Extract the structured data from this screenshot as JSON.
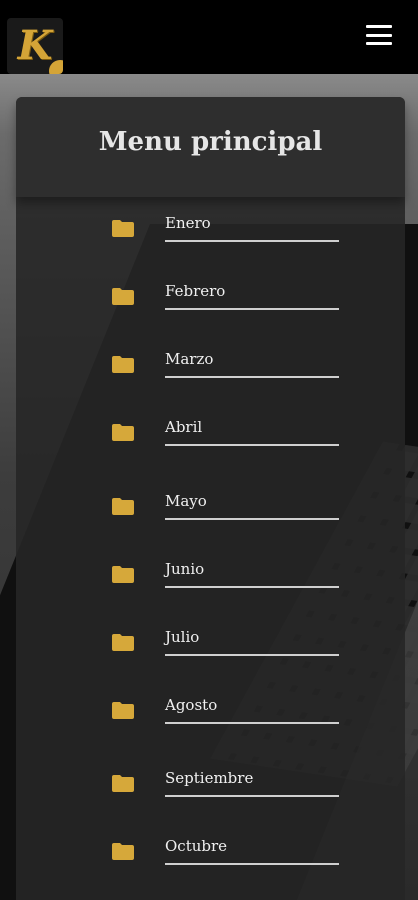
{
  "header": {
    "logo_letter": "K",
    "menu_icon": "hamburger-menu-icon"
  },
  "panel": {
    "title": "Menu principal",
    "items": [
      {
        "label": "Enero",
        "icon": "folder-icon"
      },
      {
        "label": "Febrero",
        "icon": "folder-icon"
      },
      {
        "label": "Marzo",
        "icon": "folder-icon"
      },
      {
        "label": "Abril",
        "icon": "folder-icon"
      },
      {
        "label": "Mayo",
        "icon": "folder-icon"
      },
      {
        "label": "Junio",
        "icon": "folder-icon"
      },
      {
        "label": "Julio",
        "icon": "folder-icon"
      },
      {
        "label": "Agosto",
        "icon": "folder-icon"
      },
      {
        "label": "Septiembre",
        "icon": "folder-icon"
      },
      {
        "label": "Octubre",
        "icon": "folder-icon"
      }
    ]
  },
  "colors": {
    "accent": "#d4a437",
    "folder": "#d6a83a",
    "topbar": "#000000"
  }
}
